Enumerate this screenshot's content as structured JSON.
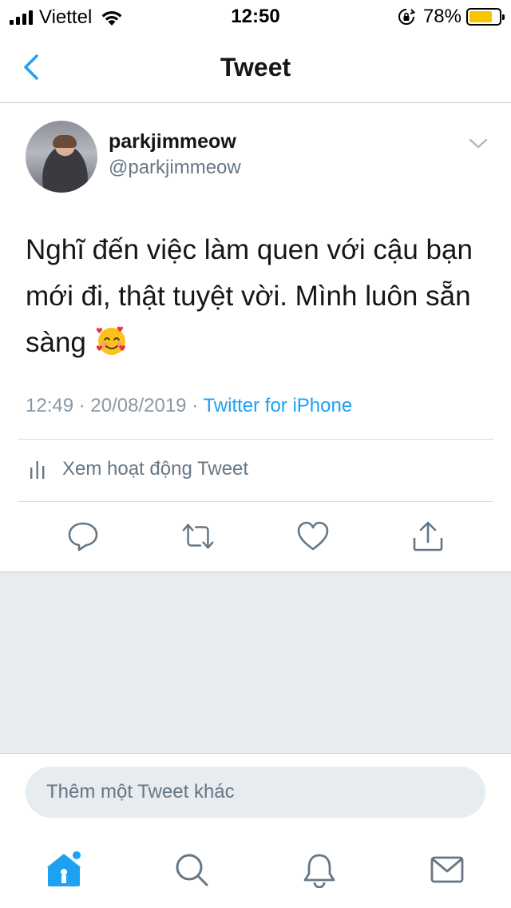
{
  "status_bar": {
    "carrier": "Viettel",
    "time": "12:50",
    "battery_percent": "78%",
    "battery_level": 0.78,
    "icons": [
      "signal-icon",
      "wifi-icon",
      "rotation-lock-icon",
      "battery-icon"
    ]
  },
  "nav": {
    "title": "Tweet",
    "back_icon": "chevron-left-icon"
  },
  "tweet": {
    "display_name": "parkjimmeow",
    "handle": "@parkjimmeow",
    "text": "Nghĩ đến việc làm quen với cậu bạn mới đi, thật tuyệt vời. Mình luôn sẵn sàng",
    "emoji": "smiling-face-with-hearts",
    "time": "12:49",
    "date": "20/08/2019",
    "separator": "·",
    "source": "Twitter for iPhone",
    "activity_label": "Xem hoạt động Tweet"
  },
  "actions": [
    "reply-icon",
    "retweet-icon",
    "like-icon",
    "share-icon"
  ],
  "compose": {
    "placeholder": "Thêm một Tweet khác"
  },
  "tabbar": {
    "items": [
      "home-icon",
      "search-icon",
      "notifications-icon",
      "messages-icon"
    ],
    "home_has_badge": true
  },
  "colors": {
    "accent": "#1da1f2",
    "secondary_text": "#657786",
    "background_gray": "#e6ecf0"
  }
}
